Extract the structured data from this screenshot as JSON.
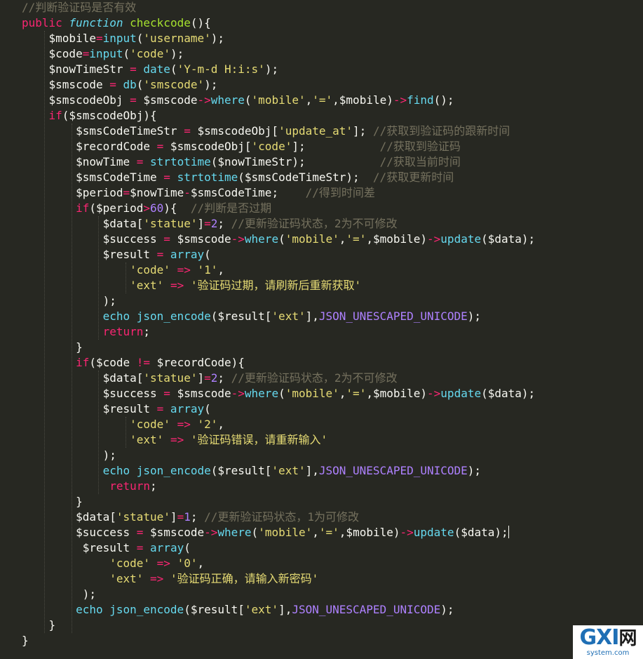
{
  "lines": [
    [
      {
        "t": "//判断验证码是否有效",
        "c": "comment"
      }
    ],
    [
      {
        "t": "public ",
        "c": "kw"
      },
      {
        "t": "function ",
        "c": "storage"
      },
      {
        "t": "checkcode",
        "c": "fn"
      },
      {
        "t": "(){",
        "c": "punc"
      }
    ],
    [
      {
        "t": "    $mobile",
        "c": "var"
      },
      {
        "t": "=",
        "c": "op"
      },
      {
        "t": "input",
        "c": "builtin"
      },
      {
        "t": "(",
        "c": "punc"
      },
      {
        "t": "'username'",
        "c": "str"
      },
      {
        "t": ");",
        "c": "punc"
      }
    ],
    [
      {
        "t": "    $code",
        "c": "var"
      },
      {
        "t": "=",
        "c": "op"
      },
      {
        "t": "input",
        "c": "builtin"
      },
      {
        "t": "(",
        "c": "punc"
      },
      {
        "t": "'code'",
        "c": "str"
      },
      {
        "t": ");",
        "c": "punc"
      }
    ],
    [
      {
        "t": "    $nowTimeStr ",
        "c": "var"
      },
      {
        "t": "=",
        "c": "op"
      },
      {
        "t": " date",
        "c": "builtin"
      },
      {
        "t": "(",
        "c": "punc"
      },
      {
        "t": "'Y-m-d H:i:s'",
        "c": "str"
      },
      {
        "t": ");",
        "c": "punc"
      }
    ],
    [
      {
        "t": "    $smscode ",
        "c": "var"
      },
      {
        "t": "=",
        "c": "op"
      },
      {
        "t": " db",
        "c": "builtin"
      },
      {
        "t": "(",
        "c": "punc"
      },
      {
        "t": "'smscode'",
        "c": "str"
      },
      {
        "t": ");",
        "c": "punc"
      }
    ],
    [
      {
        "t": "    $smscodeObj ",
        "c": "var"
      },
      {
        "t": "=",
        "c": "op"
      },
      {
        "t": " $smscode",
        "c": "var"
      },
      {
        "t": "->",
        "c": "op"
      },
      {
        "t": "where",
        "c": "builtin"
      },
      {
        "t": "(",
        "c": "punc"
      },
      {
        "t": "'mobile'",
        "c": "str"
      },
      {
        "t": ",",
        "c": "punc"
      },
      {
        "t": "'='",
        "c": "str"
      },
      {
        "t": ",$mobile)",
        "c": "var"
      },
      {
        "t": "->",
        "c": "op"
      },
      {
        "t": "find",
        "c": "builtin"
      },
      {
        "t": "();",
        "c": "punc"
      }
    ],
    [
      {
        "t": "    ",
        "c": "var"
      },
      {
        "t": "if",
        "c": "kw"
      },
      {
        "t": "($smscodeObj){",
        "c": "var"
      }
    ],
    [
      {
        "t": "        $smsCodeTimeStr ",
        "c": "var"
      },
      {
        "t": "=",
        "c": "op"
      },
      {
        "t": " $smscodeObj[",
        "c": "var"
      },
      {
        "t": "'update_at'",
        "c": "str"
      },
      {
        "t": "]; ",
        "c": "punc"
      },
      {
        "t": "//获取到验证码的跟新时间",
        "c": "comment"
      }
    ],
    [
      {
        "t": "        $recordCode ",
        "c": "var"
      },
      {
        "t": "=",
        "c": "op"
      },
      {
        "t": " $smscodeObj[",
        "c": "var"
      },
      {
        "t": "'code'",
        "c": "str"
      },
      {
        "t": "];           ",
        "c": "punc"
      },
      {
        "t": "//获取到验证码",
        "c": "comment"
      }
    ],
    [
      {
        "t": "        $nowTime ",
        "c": "var"
      },
      {
        "t": "=",
        "c": "op"
      },
      {
        "t": " strtotime",
        "c": "builtin"
      },
      {
        "t": "($nowTimeStr);           ",
        "c": "var"
      },
      {
        "t": "//获取当前时间",
        "c": "comment"
      }
    ],
    [
      {
        "t": "        $smsCodeTime ",
        "c": "var"
      },
      {
        "t": "=",
        "c": "op"
      },
      {
        "t": " strtotime",
        "c": "builtin"
      },
      {
        "t": "($smsCodeTimeStr);  ",
        "c": "var"
      },
      {
        "t": "//获取更新时间",
        "c": "comment"
      }
    ],
    [
      {
        "t": "        $period",
        "c": "var"
      },
      {
        "t": "=",
        "c": "op"
      },
      {
        "t": "$nowTime",
        "c": "var"
      },
      {
        "t": "-",
        "c": "op"
      },
      {
        "t": "$smsCodeTime;    ",
        "c": "var"
      },
      {
        "t": "//得到时间差",
        "c": "comment"
      }
    ],
    [
      {
        "t": "        ",
        "c": "var"
      },
      {
        "t": "if",
        "c": "kw"
      },
      {
        "t": "($period",
        "c": "var"
      },
      {
        "t": ">",
        "c": "op"
      },
      {
        "t": "60",
        "c": "num"
      },
      {
        "t": "){  ",
        "c": "punc"
      },
      {
        "t": "//判断是否过期",
        "c": "comment"
      }
    ],
    [
      {
        "t": "            $data[",
        "c": "var"
      },
      {
        "t": "'statue'",
        "c": "str"
      },
      {
        "t": "]",
        "c": "punc"
      },
      {
        "t": "=",
        "c": "op"
      },
      {
        "t": "2",
        "c": "num"
      },
      {
        "t": "; ",
        "c": "punc"
      },
      {
        "t": "//更新验证码状态，2为不可修改",
        "c": "comment"
      }
    ],
    [
      {
        "t": "            $success ",
        "c": "var"
      },
      {
        "t": "=",
        "c": "op"
      },
      {
        "t": " $smscode",
        "c": "var"
      },
      {
        "t": "->",
        "c": "op"
      },
      {
        "t": "where",
        "c": "builtin"
      },
      {
        "t": "(",
        "c": "punc"
      },
      {
        "t": "'mobile'",
        "c": "str"
      },
      {
        "t": ",",
        "c": "punc"
      },
      {
        "t": "'='",
        "c": "str"
      },
      {
        "t": ",$mobile)",
        "c": "var"
      },
      {
        "t": "->",
        "c": "op"
      },
      {
        "t": "update",
        "c": "builtin"
      },
      {
        "t": "($data);",
        "c": "var"
      }
    ],
    [
      {
        "t": "            $result ",
        "c": "var"
      },
      {
        "t": "=",
        "c": "op"
      },
      {
        "t": " array",
        "c": "builtin"
      },
      {
        "t": "(",
        "c": "punc"
      }
    ],
    [
      {
        "t": "                ",
        "c": "var"
      },
      {
        "t": "'code'",
        "c": "str"
      },
      {
        "t": " ",
        "c": "punc"
      },
      {
        "t": "=>",
        "c": "op"
      },
      {
        "t": " ",
        "c": "punc"
      },
      {
        "t": "'1'",
        "c": "str"
      },
      {
        "t": ",",
        "c": "punc"
      }
    ],
    [
      {
        "t": "                ",
        "c": "var"
      },
      {
        "t": "'ext'",
        "c": "str"
      },
      {
        "t": " ",
        "c": "punc"
      },
      {
        "t": "=>",
        "c": "op"
      },
      {
        "t": " ",
        "c": "punc"
      },
      {
        "t": "'验证码过期，请刷新后重新获取'",
        "c": "str"
      }
    ],
    [
      {
        "t": "            );",
        "c": "punc"
      }
    ],
    [
      {
        "t": "            ",
        "c": "var"
      },
      {
        "t": "echo",
        "c": "builtin"
      },
      {
        "t": " json_encode",
        "c": "builtin"
      },
      {
        "t": "($result[",
        "c": "var"
      },
      {
        "t": "'ext'",
        "c": "str"
      },
      {
        "t": "],",
        "c": "punc"
      },
      {
        "t": "JSON_UNESCAPED_UNICODE",
        "c": "const"
      },
      {
        "t": ");",
        "c": "punc"
      }
    ],
    [
      {
        "t": "            ",
        "c": "var"
      },
      {
        "t": "return",
        "c": "kw"
      },
      {
        "t": ";",
        "c": "punc"
      }
    ],
    [
      {
        "t": "        }",
        "c": "punc"
      }
    ],
    [
      {
        "t": "        ",
        "c": "var"
      },
      {
        "t": "if",
        "c": "kw"
      },
      {
        "t": "($code ",
        "c": "var"
      },
      {
        "t": "!=",
        "c": "op"
      },
      {
        "t": " $recordCode){",
        "c": "var"
      }
    ],
    [
      {
        "t": "            $data[",
        "c": "var"
      },
      {
        "t": "'statue'",
        "c": "str"
      },
      {
        "t": "]",
        "c": "punc"
      },
      {
        "t": "=",
        "c": "op"
      },
      {
        "t": "2",
        "c": "num"
      },
      {
        "t": "; ",
        "c": "punc"
      },
      {
        "t": "//更新验证码状态，2为不可修改",
        "c": "comment"
      }
    ],
    [
      {
        "t": "            $success ",
        "c": "var"
      },
      {
        "t": "=",
        "c": "op"
      },
      {
        "t": " $smscode",
        "c": "var"
      },
      {
        "t": "->",
        "c": "op"
      },
      {
        "t": "where",
        "c": "builtin"
      },
      {
        "t": "(",
        "c": "punc"
      },
      {
        "t": "'mobile'",
        "c": "str"
      },
      {
        "t": ",",
        "c": "punc"
      },
      {
        "t": "'='",
        "c": "str"
      },
      {
        "t": ",$mobile)",
        "c": "var"
      },
      {
        "t": "->",
        "c": "op"
      },
      {
        "t": "update",
        "c": "builtin"
      },
      {
        "t": "($data);",
        "c": "var"
      }
    ],
    [
      {
        "t": "            $result ",
        "c": "var"
      },
      {
        "t": "=",
        "c": "op"
      },
      {
        "t": " array",
        "c": "builtin"
      },
      {
        "t": "(",
        "c": "punc"
      }
    ],
    [
      {
        "t": "                ",
        "c": "var"
      },
      {
        "t": "'code'",
        "c": "str"
      },
      {
        "t": " ",
        "c": "punc"
      },
      {
        "t": "=>",
        "c": "op"
      },
      {
        "t": " ",
        "c": "punc"
      },
      {
        "t": "'2'",
        "c": "str"
      },
      {
        "t": ",",
        "c": "punc"
      }
    ],
    [
      {
        "t": "                ",
        "c": "var"
      },
      {
        "t": "'ext'",
        "c": "str"
      },
      {
        "t": " ",
        "c": "punc"
      },
      {
        "t": "=>",
        "c": "op"
      },
      {
        "t": " ",
        "c": "punc"
      },
      {
        "t": "'验证码错误，请重新输入'",
        "c": "str"
      }
    ],
    [
      {
        "t": "            );",
        "c": "punc"
      }
    ],
    [
      {
        "t": "            ",
        "c": "var"
      },
      {
        "t": "echo",
        "c": "builtin"
      },
      {
        "t": " json_encode",
        "c": "builtin"
      },
      {
        "t": "($result[",
        "c": "var"
      },
      {
        "t": "'ext'",
        "c": "str"
      },
      {
        "t": "],",
        "c": "punc"
      },
      {
        "t": "JSON_UNESCAPED_UNICODE",
        "c": "const"
      },
      {
        "t": ");",
        "c": "punc"
      }
    ],
    [
      {
        "t": "             ",
        "c": "var"
      },
      {
        "t": "return",
        "c": "kw"
      },
      {
        "t": ";",
        "c": "punc"
      }
    ],
    [
      {
        "t": "        }",
        "c": "punc"
      }
    ],
    [
      {
        "t": "        $data[",
        "c": "var"
      },
      {
        "t": "'statue'",
        "c": "str"
      },
      {
        "t": "]",
        "c": "punc"
      },
      {
        "t": "=",
        "c": "op"
      },
      {
        "t": "1",
        "c": "num"
      },
      {
        "t": "; ",
        "c": "punc"
      },
      {
        "t": "//更新验证码状态，1为可修改",
        "c": "comment"
      }
    ],
    [
      {
        "t": "        $success ",
        "c": "var"
      },
      {
        "t": "=",
        "c": "op"
      },
      {
        "t": " $smscode",
        "c": "var"
      },
      {
        "t": "->",
        "c": "op"
      },
      {
        "t": "where",
        "c": "builtin"
      },
      {
        "t": "(",
        "c": "punc"
      },
      {
        "t": "'mobile'",
        "c": "str"
      },
      {
        "t": ",",
        "c": "punc"
      },
      {
        "t": "'='",
        "c": "str"
      },
      {
        "t": ",$mobile)",
        "c": "var"
      },
      {
        "t": "->",
        "c": "op"
      },
      {
        "t": "update",
        "c": "builtin"
      },
      {
        "t": "($data);",
        "c": "var"
      },
      {
        "t": "",
        "c": "cursor"
      }
    ],
    [
      {
        "t": "         $result ",
        "c": "var"
      },
      {
        "t": "=",
        "c": "op"
      },
      {
        "t": " array",
        "c": "builtin"
      },
      {
        "t": "(",
        "c": "punc"
      }
    ],
    [
      {
        "t": "             ",
        "c": "var"
      },
      {
        "t": "'code'",
        "c": "str"
      },
      {
        "t": " ",
        "c": "punc"
      },
      {
        "t": "=>",
        "c": "op"
      },
      {
        "t": " ",
        "c": "punc"
      },
      {
        "t": "'0'",
        "c": "str"
      },
      {
        "t": ",",
        "c": "punc"
      }
    ],
    [
      {
        "t": "             ",
        "c": "var"
      },
      {
        "t": "'ext'",
        "c": "str"
      },
      {
        "t": " ",
        "c": "punc"
      },
      {
        "t": "=>",
        "c": "op"
      },
      {
        "t": " ",
        "c": "punc"
      },
      {
        "t": "'验证码正确，请输入新密码'",
        "c": "str"
      }
    ],
    [
      {
        "t": "         );",
        "c": "punc"
      }
    ],
    [
      {
        "t": "        ",
        "c": "var"
      },
      {
        "t": "echo",
        "c": "builtin"
      },
      {
        "t": " json_encode",
        "c": "builtin"
      },
      {
        "t": "($result[",
        "c": "var"
      },
      {
        "t": "'ext'",
        "c": "str"
      },
      {
        "t": "],",
        "c": "punc"
      },
      {
        "t": "JSON_UNESCAPED_UNICODE",
        "c": "const"
      },
      {
        "t": ");",
        "c": "punc"
      }
    ],
    [
      {
        "t": "    }",
        "c": "punc"
      }
    ],
    [
      {
        "t": "}",
        "c": "punc"
      }
    ]
  ],
  "watermark": {
    "logo": "GXI",
    "logo_cn": "网",
    "sub": "system.com"
  },
  "colors": {
    "background": "#272822",
    "comment": "#75715e",
    "keyword": "#f92672",
    "function": "#a6e22e",
    "builtin": "#66d9ef",
    "string": "#e6db74",
    "number": "#ae81ff"
  }
}
